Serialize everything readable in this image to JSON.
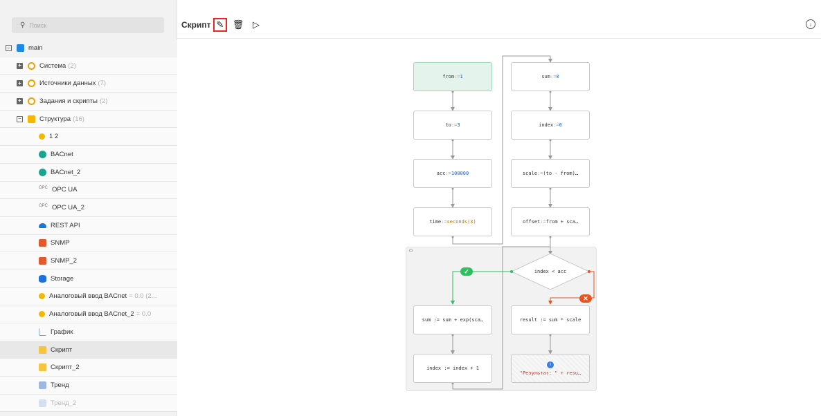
{
  "search": {
    "placeholder": "Поиск"
  },
  "tree": {
    "root": "main",
    "groups": [
      {
        "label": "Система",
        "count": "(2)"
      },
      {
        "label": "Источники данных",
        "count": "(7)"
      },
      {
        "label": "Задания и скрипты",
        "count": "(2)"
      },
      {
        "label": "Структура",
        "count": "(16)"
      }
    ],
    "items": [
      {
        "label": "1 2",
        "count": ""
      },
      {
        "label": "BACnet",
        "count": ""
      },
      {
        "label": "BACnet_2",
        "count": ""
      },
      {
        "label": "OPC UA",
        "count": "",
        "icon_text": "OPC"
      },
      {
        "label": "OPC UA_2",
        "count": "",
        "icon_text": "OPC"
      },
      {
        "label": "REST API",
        "count": ""
      },
      {
        "label": "SNMP",
        "count": ""
      },
      {
        "label": "SNMP_2",
        "count": ""
      },
      {
        "label": "Storage",
        "count": ""
      },
      {
        "label": "Аналоговый ввод BACnet",
        "count": "= 0.0 (2..."
      },
      {
        "label": "Аналоговый ввод BACnet_2",
        "count": "= 0.0"
      },
      {
        "label": "График",
        "count": ""
      },
      {
        "label": "Скрипт",
        "count": ""
      },
      {
        "label": "Скрипт_2",
        "count": ""
      },
      {
        "label": "Тренд",
        "count": ""
      },
      {
        "label": "Тренд_2",
        "count": ""
      }
    ]
  },
  "toolbar": {
    "title": "Скрипт",
    "edit_icon": "✎",
    "delete_icon": "🗑",
    "run_icon": "▷",
    "download_icon": "↓"
  },
  "flow": {
    "left": [
      {
        "var": "from",
        "op": " := ",
        "val": "1"
      },
      {
        "var": "to",
        "op": " := ",
        "val": "3"
      },
      {
        "var": "acc",
        "op": " := ",
        "val": "100000"
      },
      {
        "var": "time",
        "op": " := ",
        "val": "seconds(3)"
      }
    ],
    "right": [
      {
        "var": "sum",
        "op": " := ",
        "val": "0"
      },
      {
        "var": "index",
        "op": " := ",
        "val": "0"
      },
      {
        "var": "scale",
        "op": " := ",
        "val": "(to - from)…"
      },
      {
        "var": "offset",
        "op": " := ",
        "val": "from + sca…"
      }
    ],
    "condition": "index < acc",
    "true_badge": "✓",
    "false_badge": "✕",
    "loop_body": [
      "sum := sum + exp(sca…",
      "index := index + 1"
    ],
    "result": "result := sum * scale",
    "output_info": "i",
    "output": "\"Результат: \" + resu…"
  }
}
